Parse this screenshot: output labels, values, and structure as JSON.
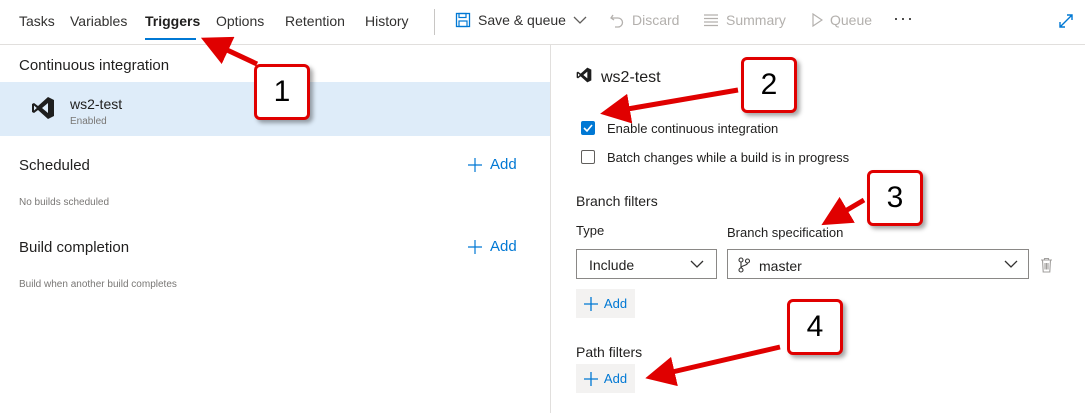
{
  "tabs": [
    "Tasks",
    "Variables",
    "Triggers",
    "Options",
    "Retention",
    "History"
  ],
  "active_tab": "Triggers",
  "toolbar": {
    "save_queue": "Save & queue",
    "discard": "Discard",
    "summary": "Summary",
    "queue": "Queue",
    "more": "···"
  },
  "left": {
    "continuous_integration": {
      "title": "Continuous integration",
      "item_name": "ws2-test",
      "item_status": "Enabled"
    },
    "scheduled": {
      "title": "Scheduled",
      "add": "Add",
      "empty": "No builds scheduled"
    },
    "build_completion": {
      "title": "Build completion",
      "add": "Add",
      "description": "Build when another build completes"
    }
  },
  "right": {
    "title": "ws2-test",
    "enable_ci": {
      "label": "Enable continuous integration",
      "checked": true
    },
    "batch_changes": {
      "label": "Batch changes while a build is in progress",
      "checked": false
    },
    "branch_filters": {
      "title": "Branch filters",
      "type_label": "Type",
      "type_value": "Include",
      "spec_label": "Branch specification",
      "spec_value": "master",
      "add": "Add"
    },
    "path_filters": {
      "title": "Path filters",
      "add": "Add"
    }
  },
  "callouts": [
    "1",
    "2",
    "3",
    "4"
  ],
  "colors": {
    "accent": "#0078d4",
    "selected_row": "#deecf9",
    "callout_red": "#e00000",
    "vs_purple": "#1e1e1e"
  }
}
